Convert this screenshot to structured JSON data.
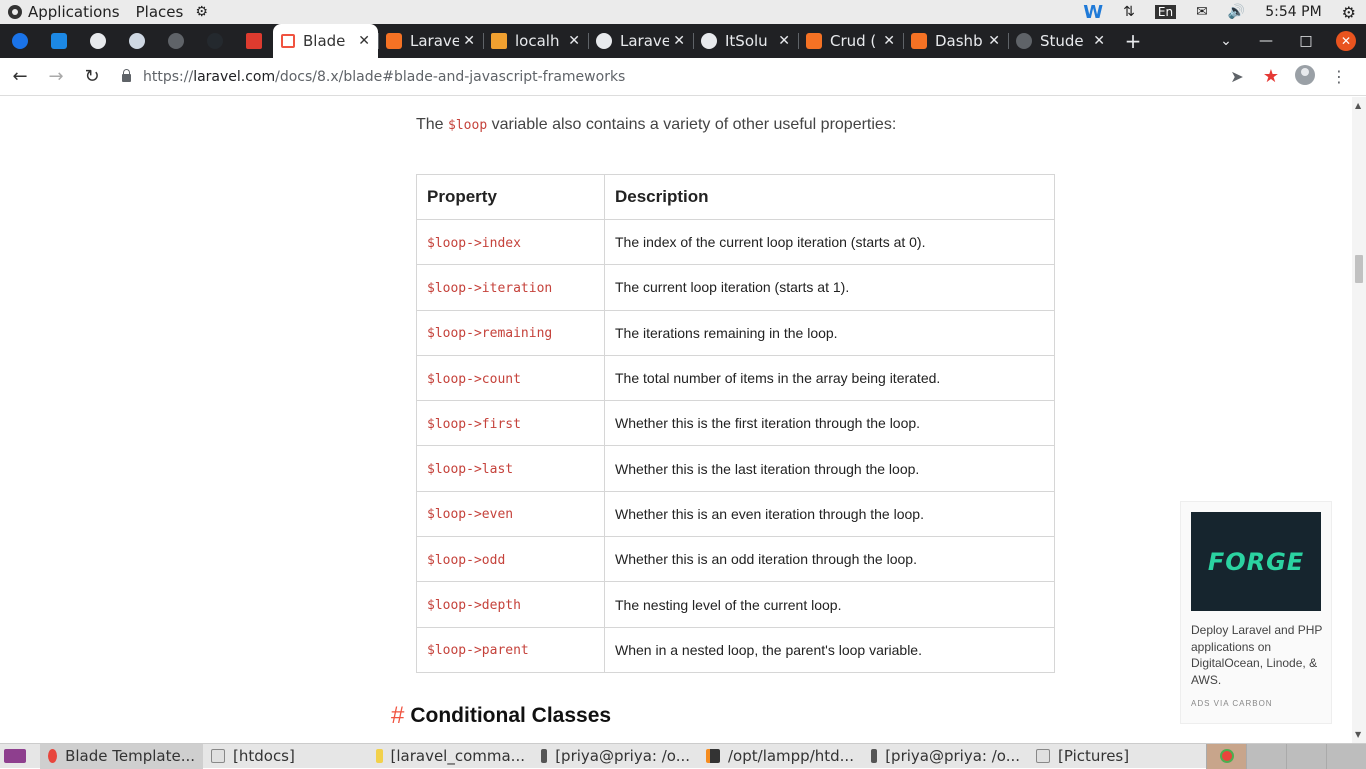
{
  "top_panel": {
    "applications": "Applications",
    "places": "Places",
    "lang": "En",
    "clock": "5:54 PM"
  },
  "tabs": [
    {
      "label": "Blade",
      "active": true
    },
    {
      "label": "Larave"
    },
    {
      "label": "localh"
    },
    {
      "label": "Larave"
    },
    {
      "label": "ItSolu"
    },
    {
      "label": "Crud ("
    },
    {
      "label": "Dashb"
    },
    {
      "label": "Stude"
    }
  ],
  "url": {
    "scheme": "https://",
    "host": "laravel.com",
    "path": "/docs/8.x/blade#blade-and-javascript-frameworks"
  },
  "content": {
    "intro_before": "The ",
    "intro_code": "$loop",
    "intro_after": " variable also contains a variety of other useful properties:",
    "table": {
      "headers": [
        "Property",
        "Description"
      ],
      "rows": [
        [
          "$loop->index",
          "The index of the current loop iteration (starts at 0)."
        ],
        [
          "$loop->iteration",
          "The current loop iteration (starts at 1)."
        ],
        [
          "$loop->remaining",
          "The iterations remaining in the loop."
        ],
        [
          "$loop->count",
          "The total number of items in the array being iterated."
        ],
        [
          "$loop->first",
          "Whether this is the first iteration through the loop."
        ],
        [
          "$loop->last",
          "Whether this is the last iteration through the loop."
        ],
        [
          "$loop->even",
          "Whether this is an even iteration through the loop."
        ],
        [
          "$loop->odd",
          "Whether this is an odd iteration through the loop."
        ],
        [
          "$loop->depth",
          "The nesting level of the current loop."
        ],
        [
          "$loop->parent",
          "When in a nested loop, the parent's loop variable."
        ]
      ]
    },
    "section_hash": "#",
    "section_title": "Conditional Classes"
  },
  "ad": {
    "logo": "FORGE",
    "text": "Deploy Laravel and PHP applications on DigitalOcean, Linode, & AWS.",
    "via": "ADS VIA CARBON"
  },
  "taskbar": [
    {
      "label": "Blade Template...",
      "active": true
    },
    {
      "label": "[htdocs]"
    },
    {
      "label": "[laravel_comma..."
    },
    {
      "label": "[priya@priya: /o..."
    },
    {
      "label": "/opt/lampp/htd..."
    },
    {
      "label": "[priya@priya: /o..."
    },
    {
      "label": "[Pictures]"
    }
  ],
  "colors": {
    "code": "#c5423b",
    "accent": "#f05340",
    "chrome_dark": "#202124"
  }
}
